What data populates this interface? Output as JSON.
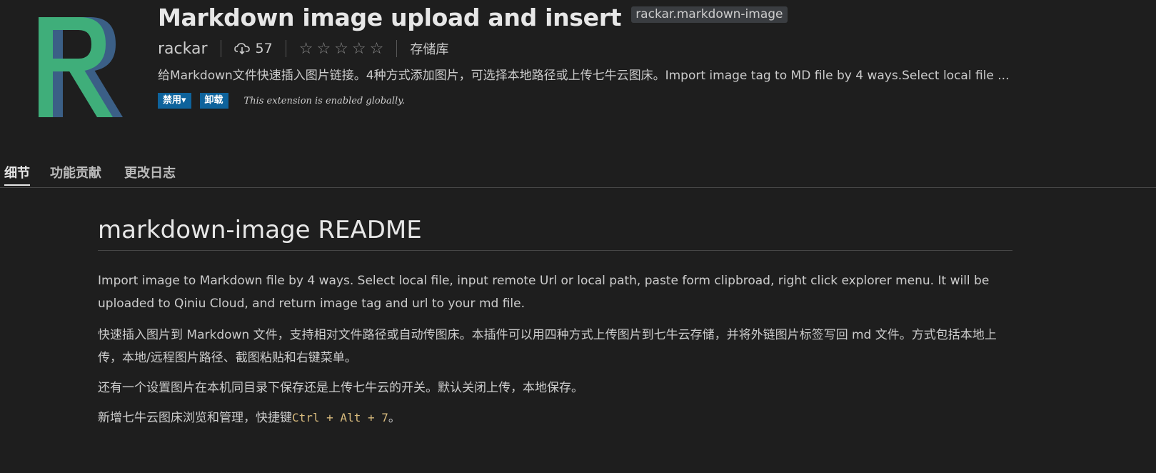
{
  "header": {
    "title": "Markdown image upload and insert",
    "extension_id": "rackar.markdown-image",
    "publisher": "rackar",
    "install_count": "57",
    "rating_stars": [
      "☆",
      "☆",
      "☆",
      "☆",
      "☆"
    ],
    "repository_label": "存储库",
    "description": "给Markdown文件快速插入图片链接。4种方式添加图片，可选择本地路径或上传七牛云图床。Import image tag to MD file by 4 ways.Select local file ...",
    "disable_button": "禁用▾",
    "uninstall_button": "卸载",
    "enabled_note": "This extension is enabled globally.",
    "logo_icon": "letter-r-logo",
    "install_icon": "cloud-download-icon"
  },
  "tabs": [
    {
      "label": "细节",
      "active": true
    },
    {
      "label": "功能贡献",
      "active": false
    },
    {
      "label": "更改日志",
      "active": false
    }
  ],
  "readme": {
    "title": "markdown-image README",
    "para1": "Import image to Markdown file by 4 ways. Select local file, input remote Url or local path, paste form clipbroad, right click explorer menu. It will be uploaded to Qiniu Cloud, and return image tag and url to your md file.",
    "para2": "快速插入图片到 Markdown 文件，支持相对文件路径或自动传图床。本插件可以用四种方式上传图片到七牛云存储，并将外链图片标签写回 md 文件。方式包括本地上传，本地/远程图片路径、截图粘贴和右键菜单。",
    "para3": "还有一个设置图片在本机同目录下保存还是上传七牛云的开关。默认关闭上传，本地保存。",
    "para4_text": "新增七牛云图床浏览和管理，快捷键",
    "para4_code": "Ctrl + Alt + 7",
    "para4_end": "。"
  },
  "colors": {
    "background": "#1e1e1e",
    "button": "#0e639c",
    "logo_green": "#3fae7a",
    "logo_shadow": "#3b5f86",
    "code": "#d7ba7d"
  }
}
